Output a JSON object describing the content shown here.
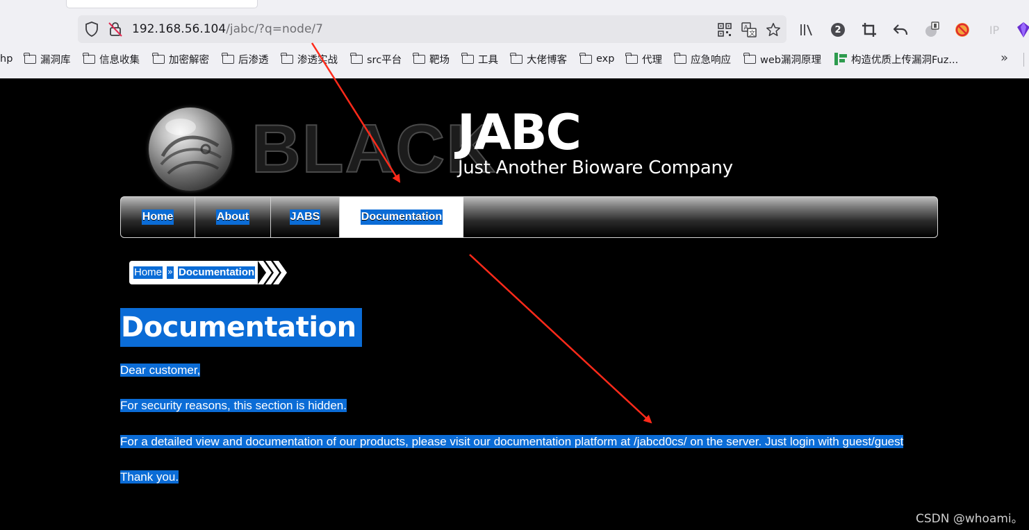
{
  "browser": {
    "url_host": "192.168.56.104",
    "url_path": "/jabc/?q=node/7",
    "icons": [
      "shield-icon",
      "insecure-lock-icon",
      "qr-code-icon",
      "translate-icon",
      "star-icon",
      "library-icon",
      "badge-count-icon",
      "crop-icon",
      "undo-icon",
      "extension-icon",
      "blocked-icon",
      "ip-icon",
      "gem-icon"
    ],
    "badge_count": "2",
    "ip_label": "IP",
    "bookmarks": [
      {
        "label": "hp",
        "type": "text"
      },
      {
        "label": "漏洞库",
        "type": "folder"
      },
      {
        "label": "信息收集",
        "type": "folder"
      },
      {
        "label": "加密解密",
        "type": "folder"
      },
      {
        "label": "后渗透",
        "type": "folder"
      },
      {
        "label": "渗透实战",
        "type": "folder"
      },
      {
        "label": "src平台",
        "type": "folder"
      },
      {
        "label": "靶场",
        "type": "folder"
      },
      {
        "label": "工具",
        "type": "folder"
      },
      {
        "label": "大佬博客",
        "type": "folder"
      },
      {
        "label": "exp",
        "type": "folder"
      },
      {
        "label": "代理",
        "type": "folder"
      },
      {
        "label": "应急响应",
        "type": "folder"
      },
      {
        "label": "web漏洞原理",
        "type": "folder"
      },
      {
        "label": "构造优质上传漏洞Fuz...",
        "type": "site"
      }
    ],
    "overflow": "»"
  },
  "site": {
    "logo_text": "BLACK",
    "title": "JABC",
    "slogan": "Just Another Bioware Company",
    "nav": [
      {
        "label": "Home",
        "active": false
      },
      {
        "label": "About",
        "active": false
      },
      {
        "label": "JABS",
        "active": false
      },
      {
        "label": "Documentation",
        "active": true
      }
    ],
    "breadcrumb": {
      "home": "Home",
      "separator": "»",
      "current": "Documentation"
    },
    "page_title": "Documentation",
    "paragraphs": [
      "Dear customer,",
      "For security reasons, this section is hidden.",
      "For a detailed view and documentation of our products, please visit our documentation platform at /jabcd0cs/ on the server. Just login with guest/guest",
      "Thank you."
    ]
  },
  "colors": {
    "selection": "#0b6cd6",
    "annotation_arrow": "#ff2a1a",
    "page_bg": "#000000"
  },
  "watermark": "CSDN @whoami。"
}
